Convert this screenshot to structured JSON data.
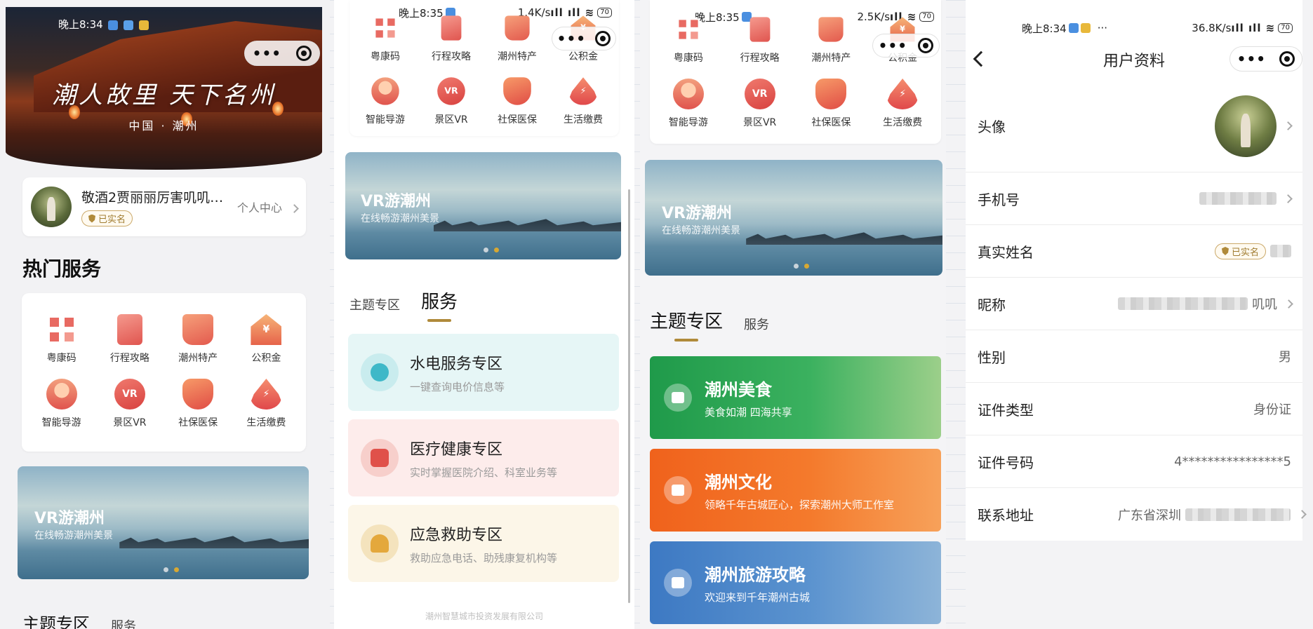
{
  "panel1": {
    "status_time": "晚上8:34",
    "hero_title": "潮人故里 天下名州",
    "hero_subtitle": "中国 · 潮州",
    "profile": {
      "name": "敬酒2贾丽丽厉害叽叽…",
      "badge": "已实名",
      "center_link": "个人中心"
    },
    "hot_services_title": "热门服务",
    "services": [
      {
        "label": "粤康码",
        "icon": "qr-code-icon"
      },
      {
        "label": "行程攻略",
        "icon": "itinerary-icon"
      },
      {
        "label": "潮州特产",
        "icon": "specialty-icon"
      },
      {
        "label": "公积金",
        "icon": "housing-fund-icon"
      },
      {
        "label": "智能导游",
        "icon": "smart-guide-icon"
      },
      {
        "label": "景区VR",
        "icon": "vr-icon"
      },
      {
        "label": "社保医保",
        "icon": "insurance-icon"
      },
      {
        "label": "生活缴费",
        "icon": "utility-payment-icon"
      }
    ],
    "banner": {
      "title": "VR游潮州",
      "subtitle": "在线畅游潮州美景"
    },
    "tabs": [
      "主题专区",
      "服务"
    ]
  },
  "panel2": {
    "status_time": "晚上8:35",
    "status_speed": "1.4K/s",
    "services_row1": [
      "粤康码",
      "行程攻略",
      "潮州特产",
      "公积金"
    ],
    "services_row2": [
      "智能导游",
      "景区VR",
      "社保医保",
      "生活缴费"
    ],
    "banner": {
      "title": "VR游潮州",
      "subtitle": "在线畅游潮州美景"
    },
    "tabs": [
      "主题专区",
      "服务"
    ],
    "zones": [
      {
        "title": "水电服务专区",
        "subtitle": "一键查询电价信息等",
        "bg": "#e6f6f6",
        "icon_bg": "#c9ecee",
        "icon_color": "#3fb8c8"
      },
      {
        "title": "医疗健康专区",
        "subtitle": "实时掌握医院介绍、科室业务等",
        "bg": "#fdeceb",
        "icon_bg": "#f7cfcb",
        "icon_color": "#e0514a"
      },
      {
        "title": "应急救助专区",
        "subtitle": "救助应急电话、助残康复机构等",
        "bg": "#fcf6e8",
        "icon_bg": "#f4e3bd",
        "icon_color": "#e4a83c"
      }
    ],
    "footer": "潮州智慧城市投资发展有限公司"
  },
  "panel3": {
    "status_time": "晚上8:35",
    "status_speed": "2.5K/s",
    "services_row1": [
      "粤康码",
      "行程攻略",
      "潮州特产",
      "公积金"
    ],
    "services_row2": [
      "智能导游",
      "景区VR",
      "社保医保",
      "生活缴费"
    ],
    "banner": {
      "title": "VR游潮州",
      "subtitle": "在线畅游潮州美景"
    },
    "tabs": [
      "主题专区",
      "服务"
    ],
    "topics": [
      {
        "title": "潮州美食",
        "subtitle": "美食如潮 四海共享",
        "bg": "linear-gradient(90deg,#1f9a4a,#3bb15f 55%,#9ccf8a)"
      },
      {
        "title": "潮州文化",
        "subtitle": "领略千年古城匠心，探索潮州大师工作室",
        "bg": "linear-gradient(90deg,#f0621c,#f47a2c 55%,#f7a15a)"
      },
      {
        "title": "潮州旅游攻略",
        "subtitle": "欢迎来到千年潮州古城",
        "bg": "linear-gradient(90deg,#3d79c3,#5b93cf 55%,#8db4d8)"
      }
    ]
  },
  "panel4": {
    "status_time": "晚上8:34",
    "status_speed": "36.8K/s",
    "nav_title": "用户资料",
    "rows": {
      "avatar": "头像",
      "phone": "手机号",
      "real_name": "真实姓名",
      "real_name_badge": "已实名",
      "nickname": "昵称",
      "nickname_suffix": "叽叽",
      "gender": "性别",
      "gender_value": "男",
      "id_type": "证件类型",
      "id_type_value": "身份证",
      "id_number": "证件号码",
      "id_number_value": "4****************5",
      "address": "联系地址",
      "address_value": "广东省深圳"
    }
  },
  "battery": "70"
}
